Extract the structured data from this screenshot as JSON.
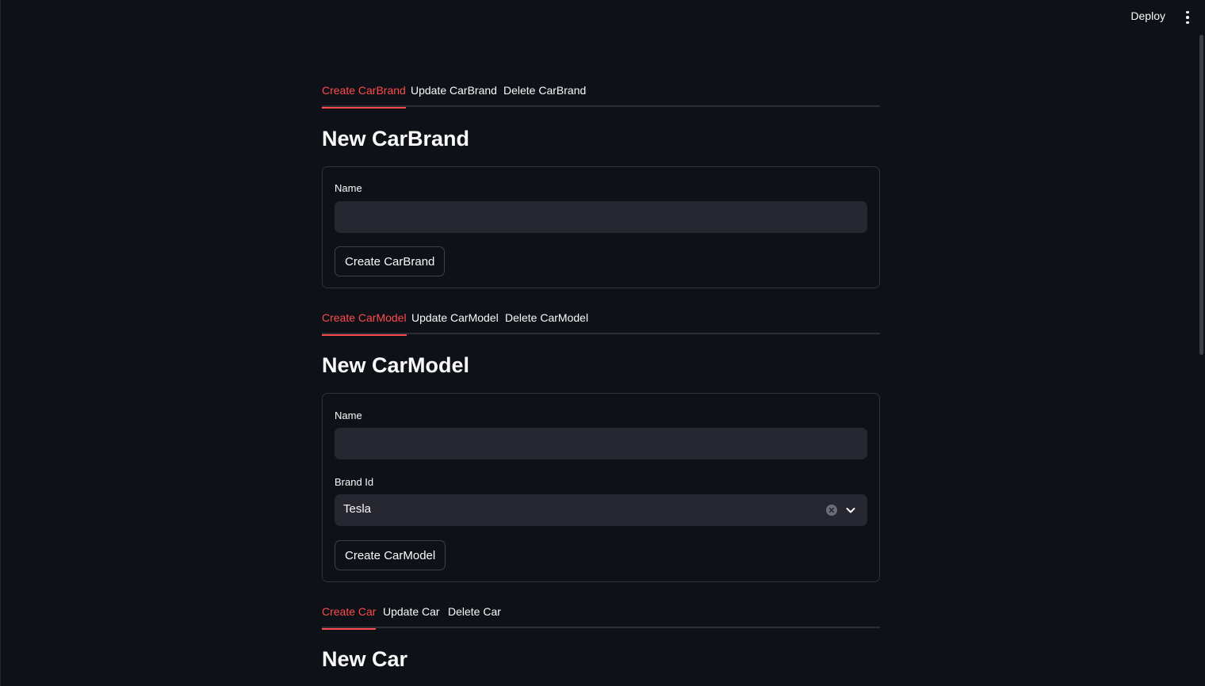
{
  "header": {
    "deploy_label": "Deploy",
    "menu_icon": "more-vertical-icon"
  },
  "brand_section": {
    "tabs": [
      "Create CarBrand",
      "Update CarBrand",
      "Delete CarBrand"
    ],
    "active_tab": 0,
    "heading": "New CarBrand",
    "name_label": "Name",
    "name_value": "",
    "submit_label": "Create CarBrand"
  },
  "model_section": {
    "tabs": [
      "Create CarModel",
      "Update CarModel",
      "Delete CarModel"
    ],
    "active_tab": 0,
    "heading": "New CarModel",
    "name_label": "Name",
    "name_value": "",
    "brand_label": "Brand Id",
    "brand_value": "Tesla",
    "submit_label": "Create CarModel"
  },
  "car_section": {
    "tabs": [
      "Create Car",
      "Update Car",
      "Delete Car"
    ],
    "active_tab": 0,
    "heading": "New Car"
  },
  "colors": {
    "accent": "#ff4b4b",
    "background": "#0e1117",
    "input_bg": "#262730"
  }
}
